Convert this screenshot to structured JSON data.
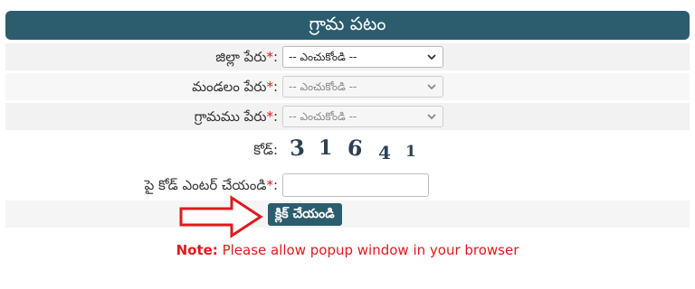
{
  "header": {
    "title": "గ్రామ పటం"
  },
  "form": {
    "district": {
      "label": "జిల్లా పేరు",
      "required_mark": "*",
      "colon": ":",
      "value": "-- ఎంచుకోండి --"
    },
    "mandal": {
      "label": "మండలం పేరు",
      "required_mark": "*",
      "colon": ":",
      "value": "-- ఎంచుకోండి --"
    },
    "village": {
      "label": "గ్రామము పేరు",
      "required_mark": "*",
      "colon": ":",
      "value": "-- ఎంచుకోండి --"
    },
    "code": {
      "label": "కోడ్:",
      "captcha_digits": [
        "3",
        "1",
        "6",
        "4",
        "1"
      ]
    },
    "enter_code": {
      "label": "పై కోడ్ ఎంటర్ చేయండి",
      "required_mark": "*",
      "colon": ":",
      "value": ""
    },
    "submit_label": "క్లిక్ చేయండి"
  },
  "note": {
    "prefix": "Note:",
    "text": " Please allow popup window in your browser"
  },
  "colors": {
    "header_bg": "#2c5d6f",
    "required": "#e0191c",
    "arrow": "#e0191c",
    "note": "#e0191c"
  },
  "icons": {
    "dropdown": "chevron-down-icon",
    "pointer": "arrow-right-icon"
  }
}
